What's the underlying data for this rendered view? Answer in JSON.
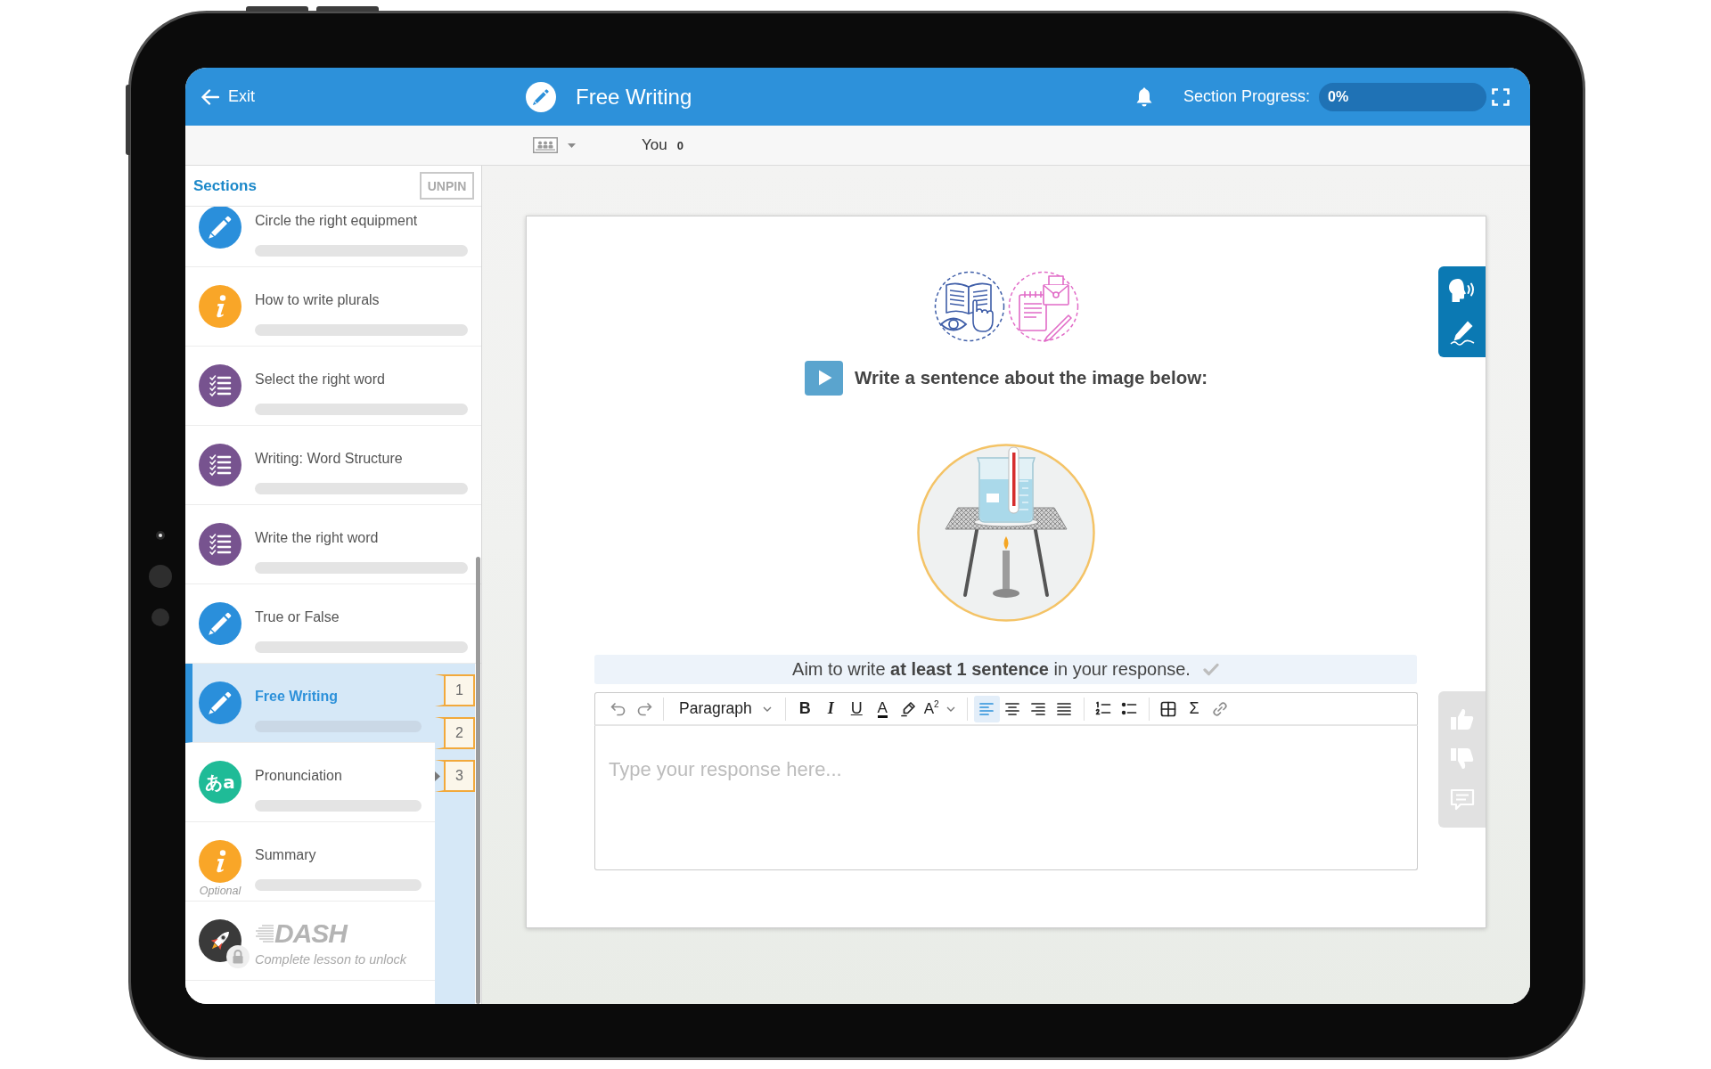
{
  "header": {
    "exit": "Exit",
    "title": "Free Writing",
    "progress_label": "Section Progress:",
    "progress": {
      "level": 0,
      "reading": "0%"
    }
  },
  "subbar": {
    "user": "You",
    "score": "0"
  },
  "sidebar": {
    "title": "Sections",
    "unpin": "UNPIN",
    "sections": [
      {
        "kind": "exercise",
        "title": "Circle the right equipment",
        "level": 0,
        "selected": false,
        "locked": false
      },
      {
        "kind": "info",
        "title": "How to write plurals",
        "level": 0,
        "selected": false,
        "locked": false
      },
      {
        "kind": "quiz",
        "title": "Select the right word",
        "level": 0,
        "selected": false,
        "locked": false
      },
      {
        "kind": "quiz",
        "title": "Writing: Word Structure",
        "level": 0,
        "selected": false,
        "locked": false
      },
      {
        "kind": "quiz",
        "title": "Write the right word",
        "level": 0,
        "selected": false,
        "locked": false
      },
      {
        "kind": "exercise",
        "title": "True or False",
        "level": 0,
        "selected": false,
        "locked": false
      },
      {
        "kind": "exercise",
        "title": "Free Writing",
        "level": 0,
        "selected": true,
        "locked": false,
        "pages": [
          {
            "label": "1",
            "selected": false
          },
          {
            "label": "2",
            "selected": false
          },
          {
            "label": "3",
            "selected": true
          }
        ]
      },
      {
        "kind": "speaking",
        "icon_text": "あa",
        "title": "Pronunciation",
        "level": 0,
        "selected": false,
        "locked": false
      },
      {
        "kind": "info",
        "title": "Summary",
        "note": "Optional",
        "level": 0,
        "selected": false,
        "locked": false
      },
      {
        "kind": "game",
        "title": "DASH",
        "subtitle": "Complete lesson to unlock",
        "selected": false,
        "locked": true
      }
    ]
  },
  "activity": {
    "prompt": "Write a sentence about the image below:",
    "hint": "Aim to write **at least 1 sentence** in your response.",
    "hint_met": false,
    "editor": {
      "toolbar": [
        [
          {
            "kind": "undo",
            "disabled": true
          },
          {
            "kind": "redo",
            "disabled": true
          }
        ],
        [
          {
            "kind": "block-format",
            "label": "Paragraph"
          }
        ],
        [
          {
            "kind": "bold",
            "label": "B"
          },
          {
            "kind": "italic",
            "label": "I"
          },
          {
            "kind": "underline",
            "label": "U"
          },
          {
            "kind": "text-color",
            "label": "A"
          },
          {
            "kind": "highlight"
          },
          {
            "kind": "script",
            "label": "A$^{2}$"
          }
        ],
        [
          {
            "kind": "align-left",
            "selected": true
          },
          {
            "kind": "align-center",
            "selected": false
          },
          {
            "kind": "align-right",
            "selected": false
          },
          {
            "kind": "justify",
            "selected": false
          }
        ],
        [
          {
            "kind": "numbered-list"
          },
          {
            "kind": "bullet-list"
          }
        ],
        [
          {
            "kind": "table",
            "disabled": false
          },
          {
            "kind": "formula",
            "label": "Σ",
            "disabled": false
          },
          {
            "kind": "link",
            "disabled": true
          }
        ]
      ],
      "placeholder": "Type your response here..."
    }
  }
}
